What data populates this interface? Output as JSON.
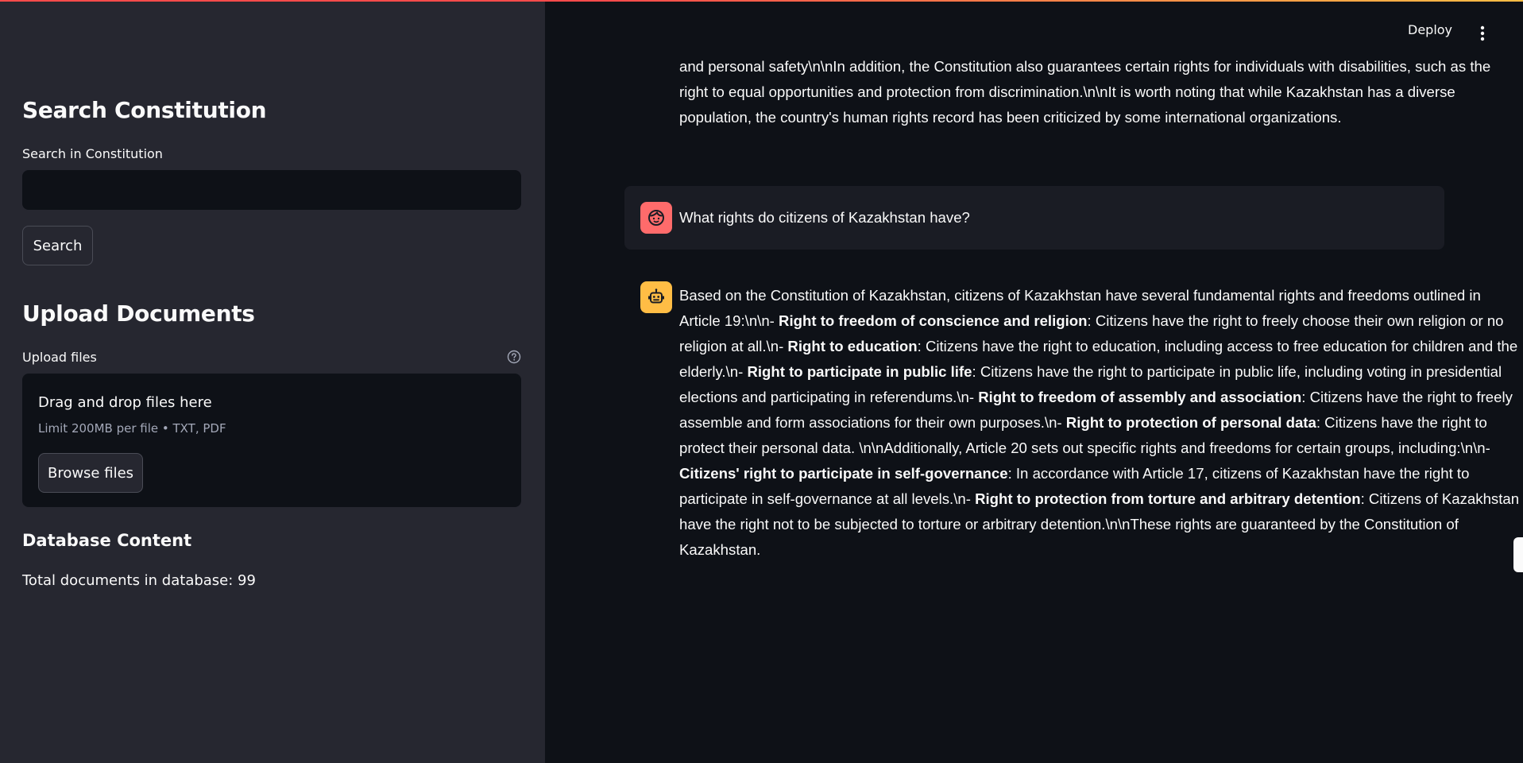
{
  "sidebar": {
    "search_heading": "Search Constitution",
    "search_label": "Search in Constitution",
    "search_value": "",
    "search_button": "Search",
    "upload_heading": "Upload Documents",
    "upload_label": "Upload files",
    "dropzone_title": "Drag and drop files here",
    "dropzone_limit": "Limit 200MB per file • TXT, PDF",
    "browse_button": "Browse files",
    "db_heading": "Database Content",
    "db_total": "Total documents in database: 99"
  },
  "header": {
    "deploy_label": "Deploy"
  },
  "chat": {
    "previous_assistant_text": "and personal safety\\n\\nIn addition, the Constitution also guarantees certain rights for individuals with disabilities, such as the right to equal opportunities and protection from discrimination.\\n\\nIt is worth noting that while Kazakhstan has a diverse population, the country's human rights record has been criticized by some international organizations.",
    "user_message": "What rights do citizens of Kazakhstan have?",
    "assistant_segments": [
      {
        "text": "Based on the Constitution of Kazakhstan, citizens of Kazakhstan have several fundamental rights and freedoms outlined in Article 19:\\n\\n- ",
        "bold": false
      },
      {
        "text": "Right to freedom of conscience and religion",
        "bold": true
      },
      {
        "text": ": Citizens have the right to freely choose their own religion or no religion at all.\\n- ",
        "bold": false
      },
      {
        "text": "Right to education",
        "bold": true
      },
      {
        "text": ": Citizens have the right to education, including access to free education for children and the elderly.\\n- ",
        "bold": false
      },
      {
        "text": "Right to participate in public life",
        "bold": true
      },
      {
        "text": ": Citizens have the right to participate in public life, including voting in presidential elections and participating in referendums.\\n- ",
        "bold": false
      },
      {
        "text": "Right to freedom of assembly and association",
        "bold": true
      },
      {
        "text": ": Citizens have the right to freely assemble and form associations for their own purposes.\\n- ",
        "bold": false
      },
      {
        "text": "Right to protection of personal data",
        "bold": true
      },
      {
        "text": ": Citizens have the right to protect their personal data. \\n\\nAdditionally, Article 20 sets out specific rights and freedoms for certain groups, including:\\n\\n- ",
        "bold": false
      },
      {
        "text": "Citizens' right to participate in self-governance",
        "bold": true
      },
      {
        "text": ": In accordance with Article 17, citizens of Kazakhstan have the right to participate in self-governance at all levels.\\n- ",
        "bold": false
      },
      {
        "text": "Right to protection from torture and arbitrary detention",
        "bold": true
      },
      {
        "text": ": Citizens of Kazakhstan have the right not to be subjected to torture or arbitrary detention.\\n\\nThese rights are guaranteed by the Constitution of Kazakhstan.",
        "bold": false
      }
    ]
  },
  "colors": {
    "sidebar_bg": "#262730",
    "main_bg": "#0e1117",
    "user_avatar": "#ff6b6b",
    "bot_avatar": "#ffbd45"
  },
  "icons": {
    "user_avatar": "face-icon",
    "bot_avatar": "robot-icon",
    "help": "help-circle-icon",
    "menu": "kebab-menu-icon"
  }
}
